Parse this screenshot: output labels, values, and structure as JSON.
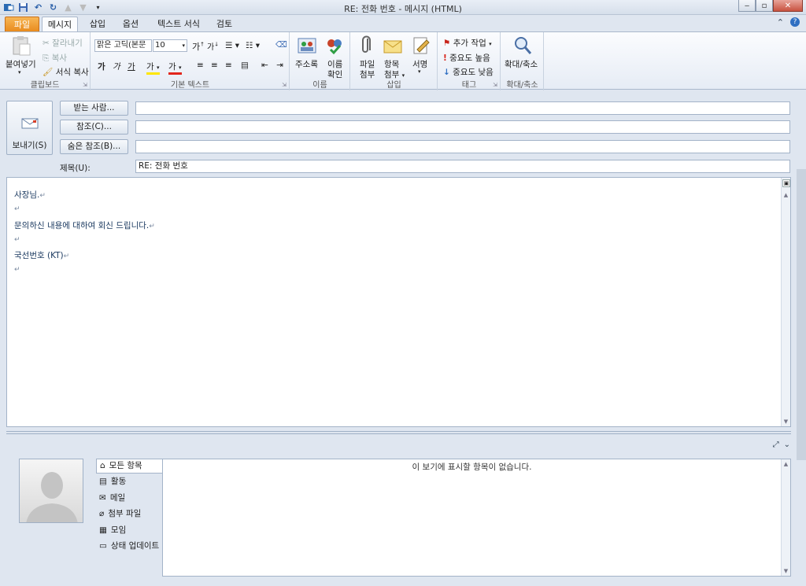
{
  "title_bar": {
    "title": "RE: 전화 번호 - 메시지 (HTML)"
  },
  "tabs": [
    {
      "label": "파일"
    },
    {
      "label": "메시지"
    },
    {
      "label": "삽입"
    },
    {
      "label": "옵션"
    },
    {
      "label": "텍스트 서식"
    },
    {
      "label": "검토"
    }
  ],
  "ribbon": {
    "clipboard": {
      "paste": "붙여넣기",
      "cut": "잘라내기",
      "copy": "복사",
      "format_painter": "서식 복사",
      "label": "클립보드"
    },
    "basic_text": {
      "font": "맑은 고딕(본문",
      "size": "10",
      "bold": "가",
      "italic": "가",
      "underline": "가",
      "highlight": "가",
      "label": "기본 텍스트"
    },
    "names": {
      "address_book": "주소록",
      "check_names_1": "이름",
      "check_names_2": "확인",
      "label": "이름"
    },
    "insert": {
      "attach_file_1": "파일",
      "attach_file_2": "첨부",
      "attach_item_1": "항목",
      "attach_item_2": "첨부",
      "signature": "서명",
      "label": "삽입"
    },
    "tags": {
      "follow_up": "추가 작업",
      "high_importance": "중요도 높음",
      "low_importance": "중요도 낮음",
      "label": "태그"
    },
    "zoom": {
      "zoom": "확대/축소",
      "label": "확대/축소"
    }
  },
  "header": {
    "send": "보내기(S)",
    "to_button": "받는 사람...",
    "cc_button": "참조(C)...",
    "bcc_button": "숨은 참조(B)...",
    "subject_label": "제목(U):",
    "to_value": "",
    "cc_value": "",
    "bcc_value": "",
    "subject_value": "RE: 전화 번호"
  },
  "body": {
    "lines": [
      "사장님.",
      "",
      "문의하신 내용에 대하여 회신 드립니다.",
      "",
      "국선번호 (KT)",
      ""
    ]
  },
  "people_pane": {
    "nav": [
      {
        "label": "모든 항목"
      },
      {
        "label": "활동"
      },
      {
        "label": "메일"
      },
      {
        "label": "첨부 파일"
      },
      {
        "label": "모임"
      },
      {
        "label": "상태 업데이트"
      }
    ],
    "empty_message": "이 보기에 표시할 항목이 없습니다."
  },
  "colors": {
    "file_tab": "#e8891b",
    "body_text": "#17365d",
    "ribbon_bg": "#fbfcfe",
    "window_bg": "#dfe6f0"
  }
}
